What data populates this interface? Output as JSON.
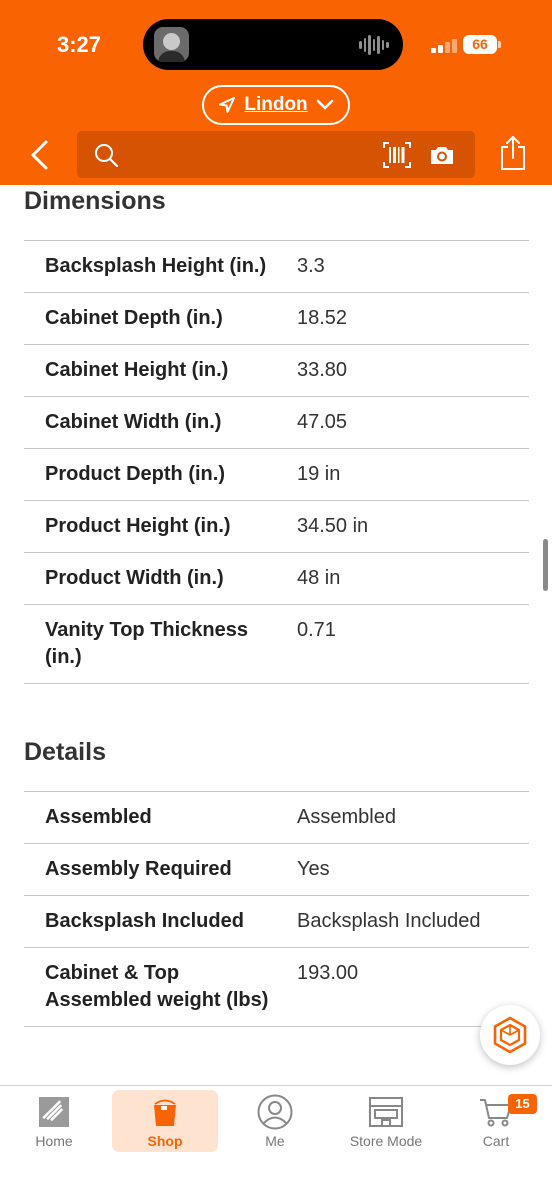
{
  "status_bar": {
    "time": "3:27",
    "battery": "66"
  },
  "header": {
    "location_label": "Lindon",
    "search_placeholder": "",
    "icons": [
      "back-chevron-icon",
      "search-icon",
      "barcode-icon",
      "camera-icon",
      "share-icon",
      "location-arrow-icon",
      "chevron-down-icon"
    ]
  },
  "colors": {
    "brand_orange": "#f96302",
    "search_bg": "#d55302",
    "active_tab_bg": "#fde3d0"
  },
  "dimensions": {
    "title": "Dimensions",
    "rows": [
      {
        "label": "Backsplash Height (in.)",
        "value": "3.3"
      },
      {
        "label": "Cabinet Depth (in.)",
        "value": "18.52"
      },
      {
        "label": "Cabinet Height (in.)",
        "value": "33.80"
      },
      {
        "label": "Cabinet Width (in.)",
        "value": "47.05"
      },
      {
        "label": "Product Depth (in.)",
        "value": "19 in"
      },
      {
        "label": "Product Height (in.)",
        "value": "34.50 in"
      },
      {
        "label": "Product Width (in.)",
        "value": "48 in"
      },
      {
        "label": "Vanity Top Thickness (in.)",
        "value": "0.71"
      }
    ]
  },
  "details": {
    "title": "Details",
    "rows": [
      {
        "label": "Assembled",
        "value": "Assembled"
      },
      {
        "label": "Assembly Required",
        "value": "Yes"
      },
      {
        "label": "Backsplash Included",
        "value": "Backsplash Included"
      },
      {
        "label": "Cabinet & Top Assembled weight (lbs)",
        "value": "193.00"
      }
    ]
  },
  "bottom_nav": {
    "items": [
      {
        "label": "Home",
        "icon": "home-depot-logo-icon"
      },
      {
        "label": "Shop",
        "icon": "bucket-icon",
        "active": true
      },
      {
        "label": "Me",
        "icon": "user-icon"
      },
      {
        "label": "Store Mode",
        "icon": "store-icon"
      },
      {
        "label": "Cart",
        "icon": "cart-icon"
      }
    ],
    "cart_count": "15"
  }
}
